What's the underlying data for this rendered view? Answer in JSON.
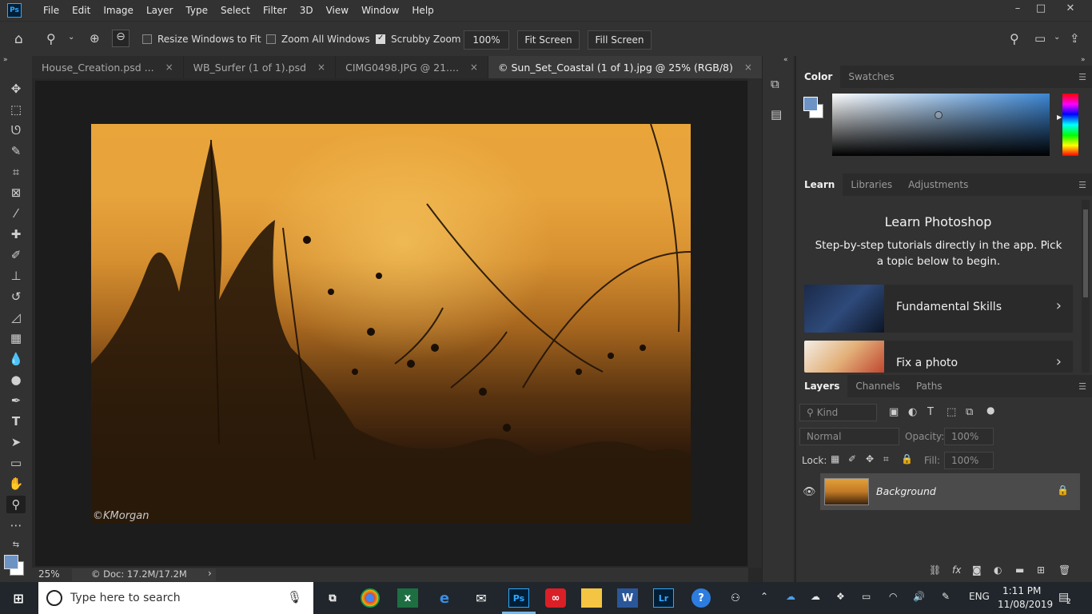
{
  "app": {
    "logo": "Ps"
  },
  "menu": [
    "File",
    "Edit",
    "Image",
    "Layer",
    "Type",
    "Select",
    "Filter",
    "3D",
    "View",
    "Window",
    "Help"
  ],
  "window_controls": [
    "–",
    "□",
    "✕"
  ],
  "options_bar": {
    "resize_windows": "Resize Windows to Fit",
    "zoom_all": "Zoom All Windows",
    "scrubby_zoom": "Scrubby Zoom",
    "zoom_value": "100%",
    "fit_screen": "Fit Screen",
    "fill_screen": "Fill Screen",
    "resize_checked": false,
    "zoom_all_checked": false,
    "scrubby_checked": true
  },
  "tabs": [
    {
      "label": "House_Creation.psd ...",
      "close": "×",
      "active": false
    },
    {
      "label": "WB_Surfer (1 of 1).psd",
      "close": "×",
      "active": false
    },
    {
      "label": "CIMG0498.JPG @ 21....",
      "close": "×",
      "active": false
    },
    {
      "label": "© Sun_Set_Coastal (1 of 1).jpg @ 25% (RGB/8)",
      "close": "×",
      "active": true
    }
  ],
  "canvas": {
    "watermark": "©KMorgan"
  },
  "status": {
    "zoom": "25%",
    "doc": "© Doc: 17.2M/17.2M",
    "arrow": "›"
  },
  "color_panel": {
    "tabs": [
      "Color",
      "Swatches"
    ],
    "fg_color": "#6d93c4",
    "bg_color": "#ffffff"
  },
  "learn_panel": {
    "tabs": [
      "Learn",
      "Libraries",
      "Adjustments"
    ],
    "title": "Learn Photoshop",
    "subtitle": "Step-by-step tutorials directly in the app. Pick a topic below to begin.",
    "cards": [
      {
        "label": "Fundamental Skills",
        "chev": "›"
      },
      {
        "label": "Fix a photo",
        "chev": "›"
      }
    ]
  },
  "layers_panel": {
    "tabs": [
      "Layers",
      "Channels",
      "Paths"
    ],
    "kind": "Kind",
    "blend": "Normal",
    "opacity_label": "Opacity:",
    "opacity": "100%",
    "lock_label": "Lock:",
    "fill_label": "Fill:",
    "fill": "100%",
    "layers": [
      {
        "name": "Background",
        "visible": true,
        "locked": true
      }
    ]
  },
  "taskbar": {
    "search_placeholder": "Type here to search",
    "time": "1:11 PM",
    "date": "11/08/2019",
    "lang": "ENG",
    "notification_count": "2"
  }
}
